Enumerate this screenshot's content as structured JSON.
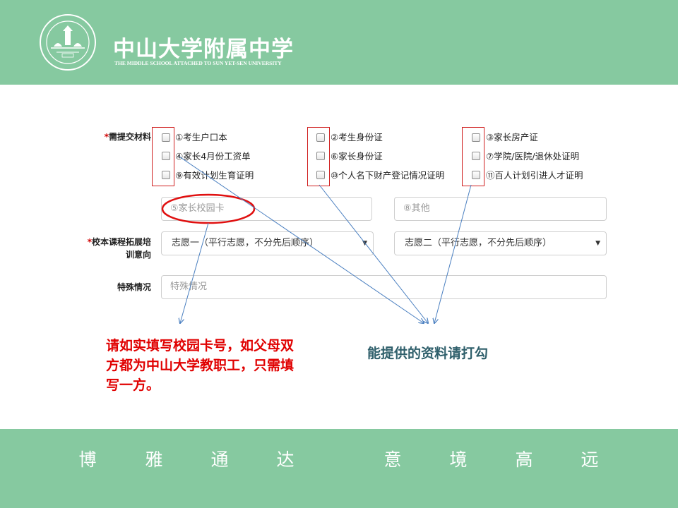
{
  "header": {
    "school_name_cn": "中山大学附属中学",
    "school_name_en": "THE MIDDLE SCHOOL ATTACHED TO  SUN YET-SEN UNIVERSITY",
    "background_color": "#86c9a0"
  },
  "form": {
    "materials": {
      "required_mark": "*",
      "label": "需提交材料",
      "columns": [
        [
          "①考生户口本",
          "④家长4月份工资单",
          "⑨有效计划生育证明"
        ],
        [
          "②考生身份证",
          "⑥家长身份证",
          "⑩个人名下财产登记情况证明"
        ],
        [
          "③家长房产证",
          "⑦学院/医院/退休处证明",
          "⑪百人计划引进人才证明"
        ]
      ]
    },
    "campus_card_placeholder": "⑤家长校园卡",
    "other_placeholder": "⑧其他",
    "course": {
      "required_mark": "*",
      "label_line1": "校本课程拓展培",
      "label_line2": "训意向",
      "choice1": "志愿一（平行志愿，不分先后顺序）",
      "choice2": "志愿二（平行志愿，不分先后顺序）"
    },
    "special": {
      "label": "特殊情况",
      "placeholder": "特殊情况"
    }
  },
  "annotations": {
    "red_note": "请如实填写校园卡号，如父母双方都为中山大学教职工，只需填写一方。",
    "teal_note": "能提供的资料请打勾",
    "red_color": "#e00000",
    "teal_color": "#2f5f6b"
  },
  "footer": {
    "motto_left": [
      "博",
      "雅",
      "通",
      "达"
    ],
    "motto_right": [
      "意",
      "境",
      "高",
      "远"
    ],
    "background_color": "#86c9a0"
  }
}
